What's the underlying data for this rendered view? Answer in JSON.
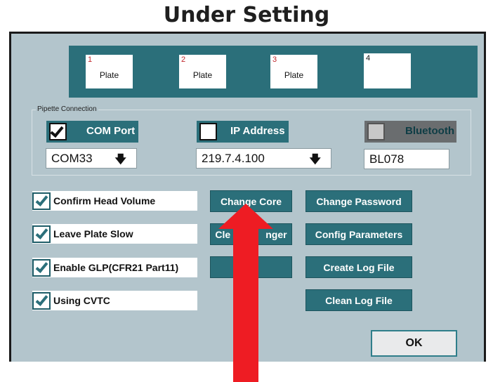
{
  "page_title": "Under Setting",
  "plates": [
    {
      "number": "1",
      "label": "Plate"
    },
    {
      "number": "2",
      "label": "Plate"
    },
    {
      "number": "3",
      "label": "Plate"
    },
    {
      "number": "4",
      "label": ""
    }
  ],
  "pipette_connection": {
    "legend": "Pipette Connection",
    "com_port": {
      "label": "COM Port",
      "checked": true,
      "value": "COM33",
      "arrow": "🡇"
    },
    "ip_address": {
      "label": "IP Address",
      "checked": false,
      "value": "219.7.4.100",
      "arrow": "🡇"
    },
    "bluetooth": {
      "label": "Bluetooth",
      "checked": false,
      "enabled": false,
      "value": "BL078"
    }
  },
  "options": [
    {
      "label": "Confirm Head Volume",
      "checked": true
    },
    {
      "label": "Leave Plate Slow",
      "checked": true
    },
    {
      "label": "Enable GLP(CFR21 Part11)",
      "checked": true
    },
    {
      "label": "Using CVTC",
      "checked": true
    }
  ],
  "buttons": {
    "change_core": "Change Core",
    "clean_changer_visible": "Cle",
    "clean_changer_visible_tail": "nger",
    "change_password": "Change Password",
    "config_parameters": "Config Parameters",
    "create_log_file": "Create Log File",
    "clean_log_file": "Clean Log File",
    "ok": "OK"
  },
  "colors": {
    "teal": "#2b6f7a",
    "panel": "#b3c5cc",
    "arrow_red": "#ee1c23"
  }
}
